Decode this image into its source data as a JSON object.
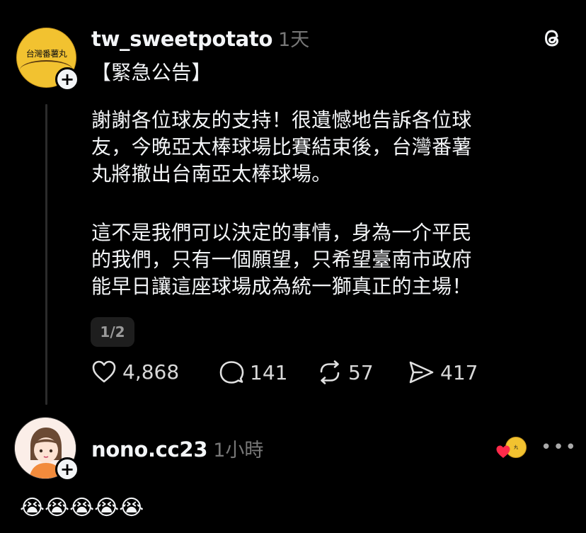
{
  "post": {
    "username": "tw_sweetpotato",
    "time": "1天",
    "avatar_text": "台灣番薯丸",
    "heading": "【緊急公告】",
    "paragraph1_lines": [
      "謝謝各位球友的支持！很遺憾地告訴各位球",
      "友，今晚亞太棒球場比賽結束後，台灣番薯",
      "丸將撤出台南亞太棒球場。"
    ],
    "paragraph2_lines": [
      "這不是我們可以決定的事情，身為一介平民",
      "的我們，只有一個願望，只希望臺南市政府",
      "能早日讓這座球場成為統一獅真正的主場！"
    ],
    "page_indicator": "1/2",
    "likes": "4,868",
    "replies": "141",
    "reposts": "57",
    "shares": "417"
  },
  "reply": {
    "username": "nono.cc23",
    "time": "1小時",
    "more_label": "•••",
    "text": "😭😭😭😭😭"
  },
  "icons": {
    "app": "threads-icon",
    "follow": "plus-icon",
    "like": "heart-icon",
    "reply": "comment-icon",
    "repost": "repost-icon",
    "share": "send-icon"
  }
}
